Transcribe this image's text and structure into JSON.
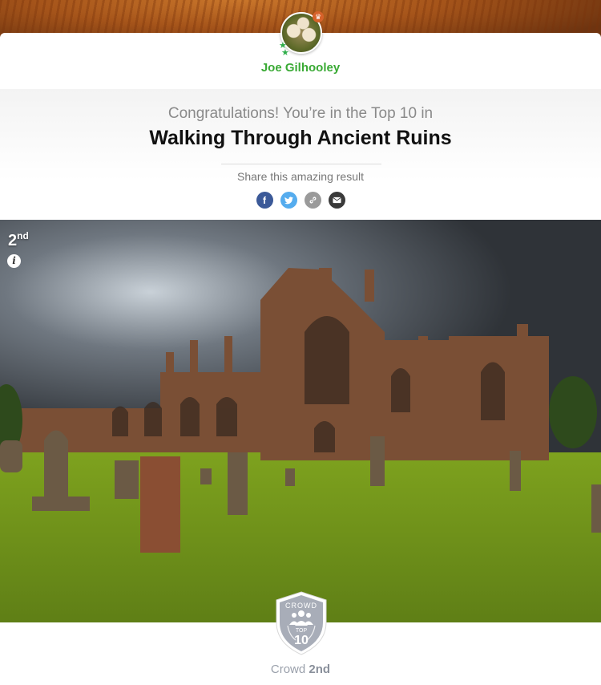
{
  "profile": {
    "username": "Joe Gilhooley",
    "avatar_alt": "barn owls avatar",
    "crown_icon": "crown-icon",
    "badge_icon": "stars-icon"
  },
  "hero": {
    "congrats_text": "Congratulations! You’re in the Top 10 in",
    "contest_title": "Walking Through Ancient Ruins",
    "share_label": "Share this amazing result"
  },
  "share": [
    {
      "name": "facebook",
      "icon": "facebook-icon",
      "glyph": "f",
      "color": "#3b5998"
    },
    {
      "name": "twitter",
      "icon": "twitter-icon",
      "glyph": "🐦",
      "color": "#55acee"
    },
    {
      "name": "copy-link",
      "icon": "link-icon",
      "glyph": "🔗",
      "color": "#9a9a9a"
    },
    {
      "name": "email",
      "icon": "envelope-icon",
      "glyph": "✉",
      "color": "#3a3a3a"
    }
  ],
  "photo": {
    "rank_number": "2",
    "rank_suffix": "nd",
    "description": "Gothic abbey ruins with graveyard under stormy sky"
  },
  "badge": {
    "top_label": "CROWD",
    "mid_label": "TOP",
    "number": "10",
    "color": "#a8adb8"
  },
  "result": {
    "category": "Crowd",
    "rank": "2nd"
  }
}
